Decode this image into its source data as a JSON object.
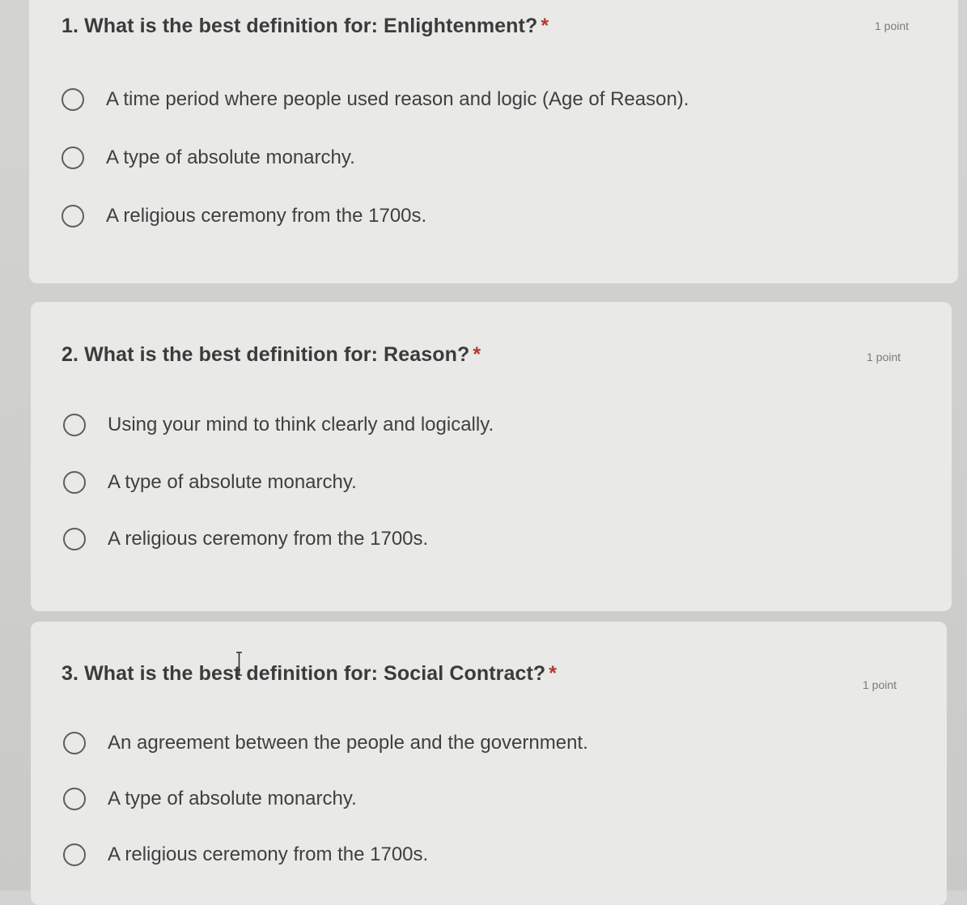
{
  "questions": [
    {
      "title": "1. What is the best definition for: Enlightenment?",
      "required_mark": "*",
      "points": "1 point",
      "options": [
        "A time period where people used reason and logic (Age of Reason).",
        "A type of absolute monarchy.",
        "A religious ceremony from the 1700s."
      ]
    },
    {
      "title": "2. What is the best definition for: Reason?",
      "required_mark": "*",
      "points": "1 point",
      "options": [
        "Using your mind to think clearly and logically.",
        "A type of absolute monarchy.",
        "A religious ceremony from the 1700s."
      ]
    },
    {
      "title": "3. What is the best definition for: Social Contract?",
      "required_mark": "*",
      "points": "1 point",
      "options": [
        "An agreement between the people and the government.",
        "A type of absolute monarchy.",
        "A religious ceremony from the 1700s."
      ]
    }
  ],
  "colors": {
    "background": "#cfcfcd",
    "card": "#e9e9e7",
    "text": "#3b3b3b",
    "required": "#b23a32",
    "radio_border": "#5e5e5e",
    "points": "#7a7a7a"
  }
}
